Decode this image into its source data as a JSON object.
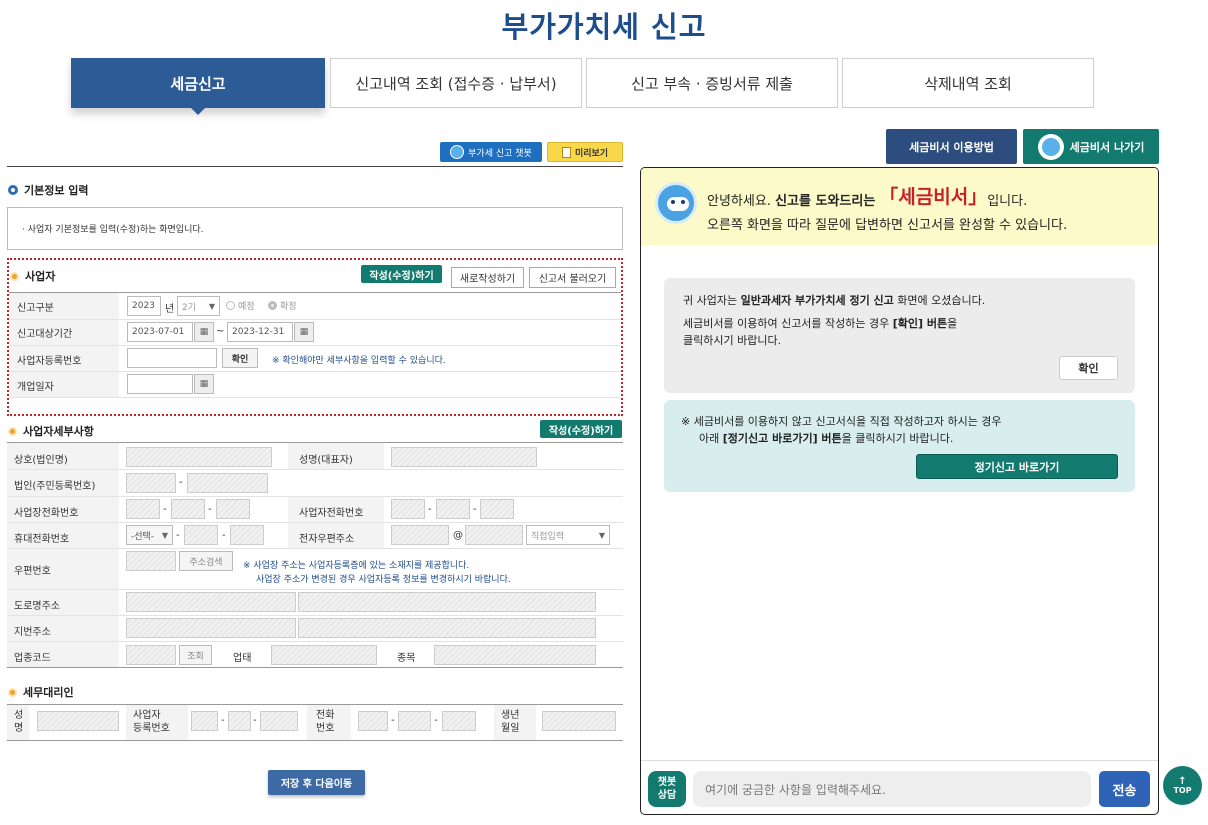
{
  "page": {
    "title": "부가가치세 신고"
  },
  "tabs": [
    {
      "label": "세금신고"
    },
    {
      "label": "신고내역 조회 (접수증 · 납부서)"
    },
    {
      "label": "신고 부속 · 증빙서류 제출"
    },
    {
      "label": "삭제내역 조회"
    }
  ],
  "toolbar": {
    "chatbot_label": "부가세 신고 챗봇",
    "preview_label": "미리보기"
  },
  "basic": {
    "title": "기본정보 입력",
    "notice": "· 사업자 기본정보를 입력(수정)하는 화면입니다."
  },
  "business": {
    "title": "사업자",
    "write_btn": "작성(수정)하기",
    "new_btn": "새로작성하기",
    "load_btn": "신고서 불러오기",
    "rows": {
      "report_type": {
        "label": "신고구분",
        "year": "2023",
        "year_unit": "년",
        "period": "2기",
        "opt1": "예정",
        "opt2": "확정"
      },
      "period": {
        "label": "신고대상기간",
        "from": "2023-07-01",
        "tilde": "~",
        "to": "2023-12-31"
      },
      "regno": {
        "label": "사업자등록번호",
        "confirm": "확인",
        "note": "※ 확인해야만 세부사항을 입력할 수 있습니다."
      },
      "open_date": {
        "label": "개업일자"
      }
    }
  },
  "detail": {
    "title": "사업자세부사항",
    "write_btn": "작성(수정)하기",
    "labels": {
      "company": "상호(법인명)",
      "ceo": "성명(대표자)",
      "corp_no": "법인(주민등록번호)",
      "biz_tel": "사업장전화번호",
      "owner_tel": "사업자전화번호",
      "mobile": "휴대전화번호",
      "email": "전자우편주소",
      "zip": "우편번호",
      "road": "도로명주소",
      "jibun": "지번주소",
      "industry": "업종코드",
      "type": "업태",
      "item": "종목"
    },
    "mobile_select": "-선택-",
    "email_at": "@",
    "email_domain": "직접입력",
    "zip_btn": "주소검색",
    "zip_note1": "※ 사업장 주소는 사업자등록증에 있는 소재지를 제공합니다.",
    "zip_note2": "사업장 주소가 변경된 경우 사업자등록 정보를 변경하시기 바랍니다.",
    "industry_btn": "조회",
    "dash": "-"
  },
  "agent": {
    "title": "세무대리인",
    "name": "성명",
    "regno": "사업자\n등록번호",
    "tel": "전화\n번호",
    "birth": "생년\n월일"
  },
  "save_btn": "저장 후 다음이동",
  "right_header": {
    "howto_btn": "세금비서 이용방법",
    "exit_btn": "세금비서 나가기"
  },
  "chat": {
    "greeting_pre": "안녕하세요. ",
    "greeting_bold": "신고를 도와드리는",
    "greeting_name": "「세금비서」",
    "greeting_post": "입니다.",
    "greeting_line2": "오른쪽 화면을 따라 질문에 답변하면 신고서를 완성할 수 있습니다.",
    "msg1_pre": "귀 사업자는 ",
    "msg1_bold": "일반과세자 부가가치세 정기 신고",
    "msg1_post": " 화면에 오셨습니다.",
    "msg1_line2_pre": "세금비서를 이용하여 신고서를 작성하는 경우 ",
    "msg1_line2_bold": "[확인] 버튼",
    "msg1_line2_post": "을",
    "msg1_line3": "클릭하시기 바랍니다.",
    "msg1_btn": "확인",
    "msg2_line1": "※ 세금비서를 이용하지 않고 신고서식을 직접 작성하고자 하시는 경우",
    "msg2_line2_pre": "아래 ",
    "msg2_line2_bold": "[정기신고 바로가기] 버튼",
    "msg2_line2_post": "을 클릭하시기 바랍니다.",
    "msg2_btn": "정기신고 바로가기",
    "badge": "챗봇\n상담",
    "placeholder": "여기에 궁금한 사항을 입력해주세요.",
    "send": "전송"
  },
  "top_btn": "TOP"
}
